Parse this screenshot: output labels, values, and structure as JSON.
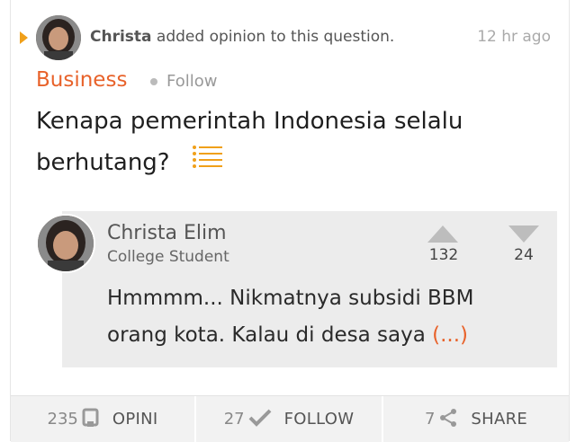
{
  "activity": {
    "user": "Christa",
    "action": "added opinion to this question.",
    "time": "12 hr ago"
  },
  "topic": {
    "name": "Business",
    "follow_label": "Follow"
  },
  "question": {
    "title": "Kenapa pemerintah Indonesia selalu berhutang?"
  },
  "answer": {
    "author_name": "Christa Elim",
    "author_role": "College Student",
    "upvotes": "132",
    "downvotes": "24",
    "text": "Hmmmm... Nikmatnya subsidi BBM orang kota. Kalau di desa saya",
    "more": "(...)"
  },
  "actions": {
    "opinions_count": "235",
    "opinions_label": "OPINI",
    "follow_count": "27",
    "follow_label": "FOLLOW",
    "share_count": "7",
    "share_label": "SHARE"
  },
  "colors": {
    "accent": "#e8622a",
    "caret": "#f0a01a",
    "answer_bg": "#ececec",
    "action_bar_bg": "#f2f2f2"
  },
  "icons": [
    "caret-right-icon",
    "list-icon",
    "vote-up-icon",
    "vote-down-icon",
    "opinion-icon",
    "check-icon",
    "share-icon"
  ]
}
